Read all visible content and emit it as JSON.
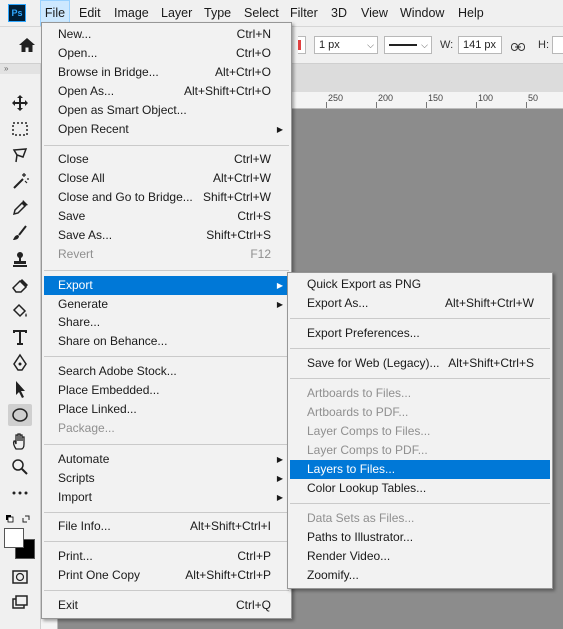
{
  "app": {
    "logo_text": "Ps"
  },
  "menubar": {
    "items": [
      {
        "label": "File",
        "active": true
      },
      {
        "label": "Edit"
      },
      {
        "label": "Image"
      },
      {
        "label": "Layer"
      },
      {
        "label": "Type"
      },
      {
        "label": "Select"
      },
      {
        "label": "Filter"
      },
      {
        "label": "3D"
      },
      {
        "label": "View"
      },
      {
        "label": "Window"
      },
      {
        "label": "Help"
      }
    ]
  },
  "options_bar": {
    "stroke_width": "1 px",
    "width_label": "W:",
    "width_value": "141 px",
    "height_label": "H:"
  },
  "ruler": {
    "labels": [
      "250",
      "200",
      "150",
      "100",
      "50"
    ]
  },
  "file_menu": {
    "items": [
      {
        "label": "New...",
        "shortcut": "Ctrl+N"
      },
      {
        "label": "Open...",
        "shortcut": "Ctrl+O"
      },
      {
        "label": "Browse in Bridge...",
        "shortcut": "Alt+Ctrl+O"
      },
      {
        "label": "Open As...",
        "shortcut": "Alt+Shift+Ctrl+O"
      },
      {
        "label": "Open as Smart Object...",
        "shortcut": ""
      },
      {
        "label": "Open Recent",
        "shortcut": "",
        "submenu": true
      },
      {
        "label": "Close",
        "shortcut": "Ctrl+W"
      },
      {
        "label": "Close All",
        "shortcut": "Alt+Ctrl+W"
      },
      {
        "label": "Close and Go to Bridge...",
        "shortcut": "Shift+Ctrl+W"
      },
      {
        "label": "Save",
        "shortcut": "Ctrl+S"
      },
      {
        "label": "Save As...",
        "shortcut": "Shift+Ctrl+S"
      },
      {
        "label": "Revert",
        "shortcut": "F12",
        "disabled": true
      },
      {
        "label": "Export",
        "shortcut": "",
        "submenu": true,
        "highlighted": true
      },
      {
        "label": "Generate",
        "shortcut": "",
        "submenu": true
      },
      {
        "label": "Share...",
        "shortcut": ""
      },
      {
        "label": "Share on Behance...",
        "shortcut": ""
      },
      {
        "label": "Search Adobe Stock...",
        "shortcut": ""
      },
      {
        "label": "Place Embedded...",
        "shortcut": ""
      },
      {
        "label": "Place Linked...",
        "shortcut": ""
      },
      {
        "label": "Package...",
        "shortcut": "",
        "disabled": true
      },
      {
        "label": "Automate",
        "shortcut": "",
        "submenu": true
      },
      {
        "label": "Scripts",
        "shortcut": "",
        "submenu": true
      },
      {
        "label": "Import",
        "shortcut": "",
        "submenu": true
      },
      {
        "label": "File Info...",
        "shortcut": "Alt+Shift+Ctrl+I"
      },
      {
        "label": "Print...",
        "shortcut": "Ctrl+P"
      },
      {
        "label": "Print One Copy",
        "shortcut": "Alt+Shift+Ctrl+P"
      },
      {
        "label": "Exit",
        "shortcut": "Ctrl+Q"
      }
    ]
  },
  "export_menu": {
    "items": [
      {
        "label": "Quick Export as PNG",
        "shortcut": ""
      },
      {
        "label": "Export As...",
        "shortcut": "Alt+Shift+Ctrl+W"
      },
      {
        "label": "Export Preferences...",
        "shortcut": ""
      },
      {
        "label": "Save for Web (Legacy)...",
        "shortcut": "Alt+Shift+Ctrl+S"
      },
      {
        "label": "Artboards to Files...",
        "shortcut": "",
        "disabled": true
      },
      {
        "label": "Artboards to PDF...",
        "shortcut": "",
        "disabled": true
      },
      {
        "label": "Layer Comps to Files...",
        "shortcut": "",
        "disabled": true
      },
      {
        "label": "Layer Comps to PDF...",
        "shortcut": "",
        "disabled": true
      },
      {
        "label": "Layers to Files...",
        "shortcut": "",
        "highlighted": true
      },
      {
        "label": "Color Lookup Tables...",
        "shortcut": ""
      },
      {
        "label": "Data Sets as Files...",
        "shortcut": "",
        "disabled": true
      },
      {
        "label": "Paths to Illustrator...",
        "shortcut": ""
      },
      {
        "label": "Render Video...",
        "shortcut": ""
      },
      {
        "label": "Zoomify...",
        "shortcut": ""
      }
    ]
  },
  "tools": [
    "move-icon",
    "marquee-icon",
    "lasso-icon",
    "magic-wand-icon",
    "eyedropper-icon",
    "brush-icon",
    "stamp-icon",
    "eraser-icon",
    "paint-bucket-icon",
    "type-icon",
    "pen-icon",
    "path-select-icon",
    "ellipse-icon",
    "hand-icon",
    "zoom-icon",
    "more-tools-icon"
  ],
  "colors": {
    "highlight": "#0078d7",
    "menubar_active": "#cde8ff",
    "canvas_bg": "#8c8c8c"
  }
}
